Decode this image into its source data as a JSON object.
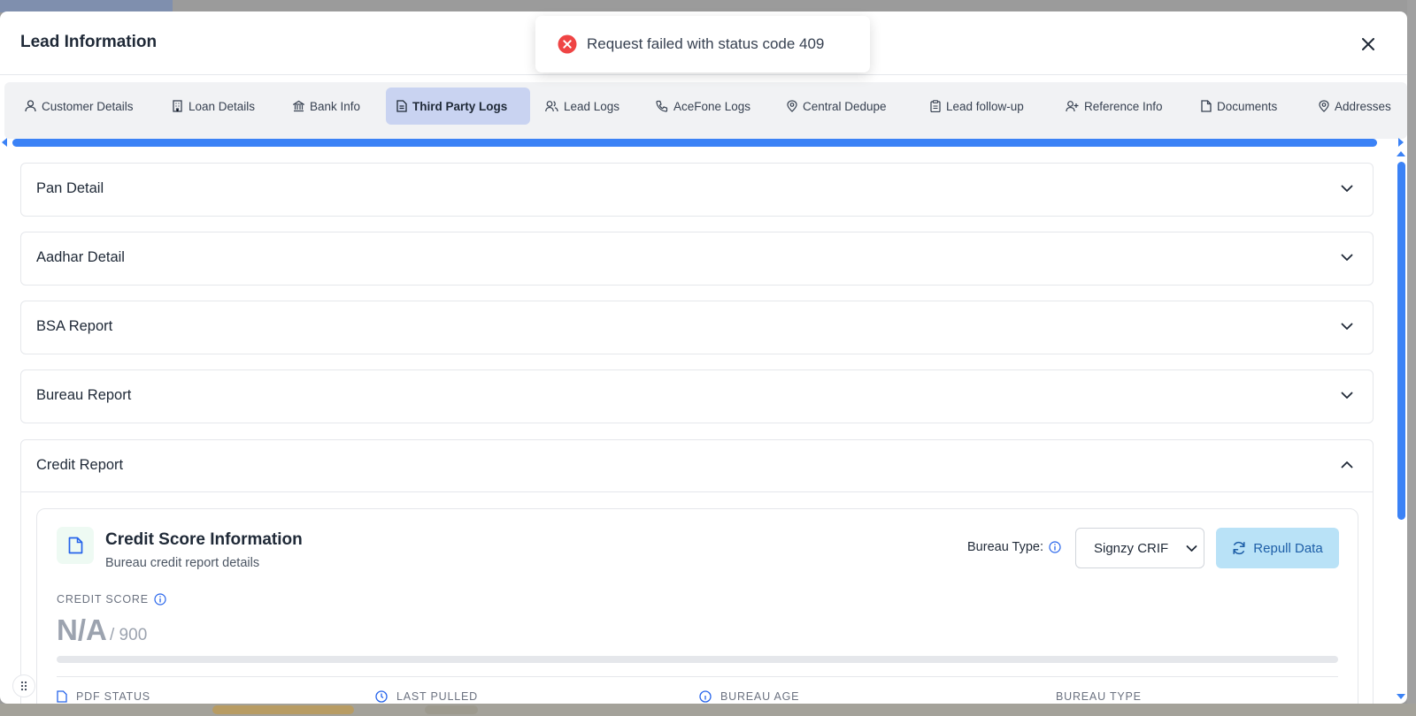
{
  "modal": {
    "title": "Lead Information"
  },
  "toast": {
    "message": "Request failed with status code 409",
    "icon": "error-circle-icon",
    "color": "#ef4444"
  },
  "tabs": [
    {
      "label": "Customer Details",
      "icon": "user-icon",
      "active": false
    },
    {
      "label": "Loan Details",
      "icon": "building-icon",
      "active": false
    },
    {
      "label": "Bank Info",
      "icon": "bank-icon",
      "active": false
    },
    {
      "label": "Third Party Logs",
      "icon": "file-text-icon",
      "active": true
    },
    {
      "label": "Lead Logs",
      "icon": "users-icon",
      "active": false
    },
    {
      "label": "AceFone Logs",
      "icon": "phone-icon",
      "active": false
    },
    {
      "label": "Central Dedupe",
      "icon": "map-pin-icon",
      "active": false
    },
    {
      "label": "Lead follow-up",
      "icon": "clipboard-icon",
      "active": false
    },
    {
      "label": "Reference Info",
      "icon": "user-plus-icon",
      "active": false
    },
    {
      "label": "Documents",
      "icon": "file-icon",
      "active": false
    },
    {
      "label": "Addresses",
      "icon": "map-pin-icon",
      "active": false
    }
  ],
  "sections": [
    {
      "title": "Pan Detail",
      "expanded": false
    },
    {
      "title": "Aadhar Detail",
      "expanded": false
    },
    {
      "title": "BSA Report",
      "expanded": false
    },
    {
      "title": "Bureau Report",
      "expanded": false
    },
    {
      "title": "Credit Report",
      "expanded": true
    }
  ],
  "credit_card": {
    "title": "Credit Score Information",
    "subtitle": "Bureau credit report details",
    "bureau_type_label": "Bureau Type:",
    "bureau_type_value": "Signzy CRIF",
    "repull_label": "Repull Data",
    "credit_score_label": "CREDIT SCORE",
    "credit_score_value": "N/A",
    "credit_score_max": "/ 900",
    "meta": [
      "PDF STATUS",
      "LAST PULLED",
      "BUREAU AGE",
      "BUREAU TYPE"
    ]
  },
  "colors": {
    "accent": "#3b82f6",
    "active_tab": "#c9d3f1",
    "repull_bg": "#b9e2f7",
    "error": "#ef4444"
  }
}
